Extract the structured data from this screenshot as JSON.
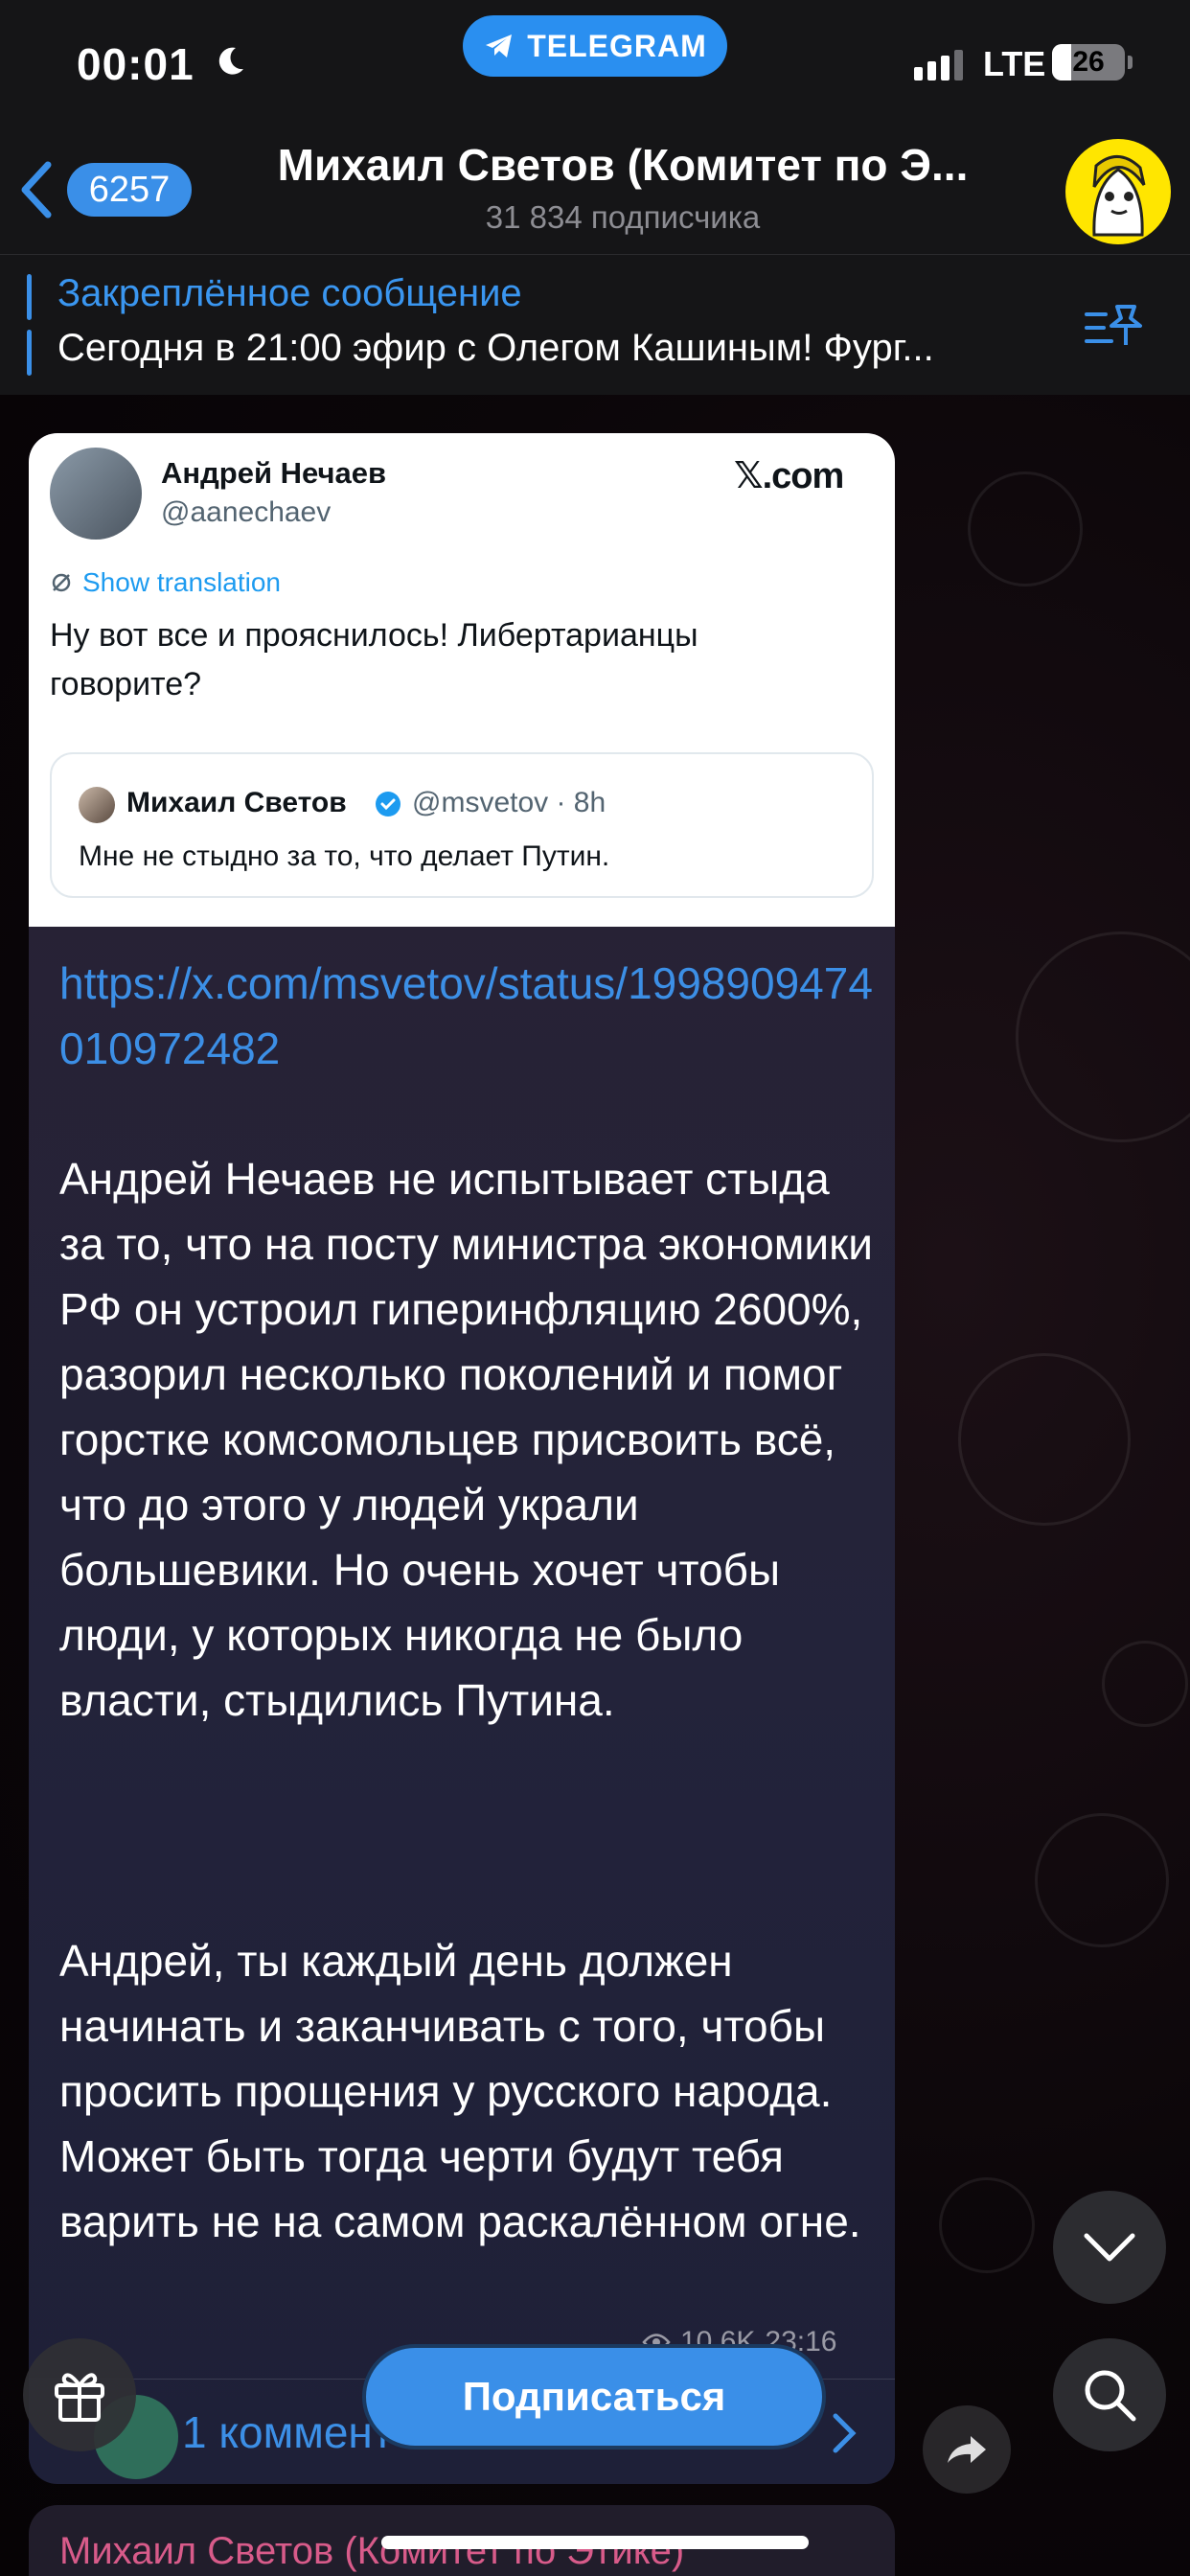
{
  "status": {
    "time": "00:01",
    "network": "LTE",
    "battery": "26",
    "battery_level": 0.26
  },
  "app_pill": {
    "label": "TELEGRAM"
  },
  "header": {
    "back_count": "6257",
    "title": "Михаил Светов (Комитет по Э...",
    "subtitle": "31 834 подписчика"
  },
  "pinned": {
    "title": "Закреплённое сообщение",
    "text": "Сегодня в 21:00 эфир с Олегом Кашиным! Фург..."
  },
  "tweet": {
    "author": "Андрей Нечаев",
    "handle": "@aanechaev",
    "site": "𝕏.com",
    "translate": "Show translation",
    "body": "Ну вот все и прояснилось! Либертарианцы говорите?",
    "quote": {
      "author": "Михаил Светов",
      "handle": "@msvetov · 8h",
      "text": "Мне не стыдно за то, что делает Путин."
    }
  },
  "message": {
    "link": "https://x.com/msvetov/status/1998909474010972482",
    "paragraph1": "Андрей Нечаев не испытывает стыда за то, что на посту министра экономики РФ он устроил гиперинфляцию 2600%, разорил несколько поколений и помог горстке комсомольцев присвоить всё, что до этого у людей украли большевики. Но очень хочет чтобы люди, у которых никогда не было власти, стыдились Путина.",
    "paragraph2": "Андрей, ты каждый день должен начинать и заканчивать с того, чтобы просить прощения у русского народа. Может быть тогда черти будут тебя варить не на самом раскалённом огне.",
    "views": "10.6K",
    "time": "23:16",
    "comments": "1 коммент"
  },
  "next_message": {
    "author": "Михаил Светов (Комитет по Этике)"
  },
  "subscribe": {
    "label": "Подписаться"
  },
  "colors": {
    "accent": "#3a8fe8",
    "link": "#3c8fe6",
    "telegram": "#2a8ff0"
  }
}
